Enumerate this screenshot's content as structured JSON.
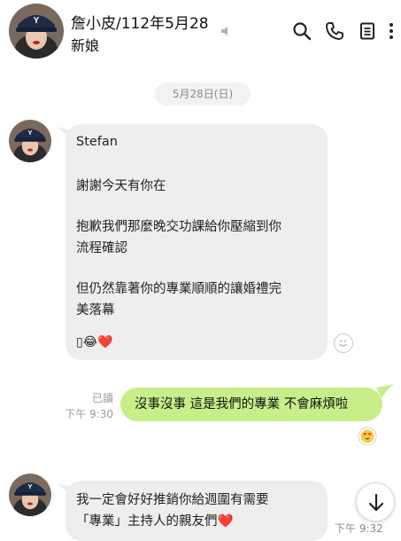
{
  "header": {
    "name": "詹小皮/112年5月28",
    "subtitle": "新娘",
    "icons": [
      "mute-icon",
      "search-icon",
      "phone-icon",
      "notes-icon",
      "more-icon"
    ]
  },
  "date_divider": "5月28日(日)",
  "messages": [
    {
      "direction": "in",
      "lines": [
        "Stefan",
        "",
        "謝謝今天有你在",
        "",
        "抱歉我們那麼晚交功課給你壓縮到你",
        "流程確認",
        "",
        "但仍然靠著你的專業順順的讓婚禮完",
        "美落幕",
        ""
      ],
      "emoji_line": "▯😂❤️"
    },
    {
      "direction": "out",
      "text": "沒事沒事 這是我們的專業 不會麻煩啦",
      "read": "已讀",
      "time": "下午 9:30"
    },
    {
      "direction": "in",
      "lines": [
        "我一定會好好推銷你給週圍有需要",
        "「專業」主持人的親友們❤️"
      ],
      "time": "下午 9:32"
    }
  ],
  "colors": {
    "incoming_bubble": "#eeeeee",
    "outgoing_bubble": "#c8ee8a",
    "heart": "#e0262d"
  }
}
